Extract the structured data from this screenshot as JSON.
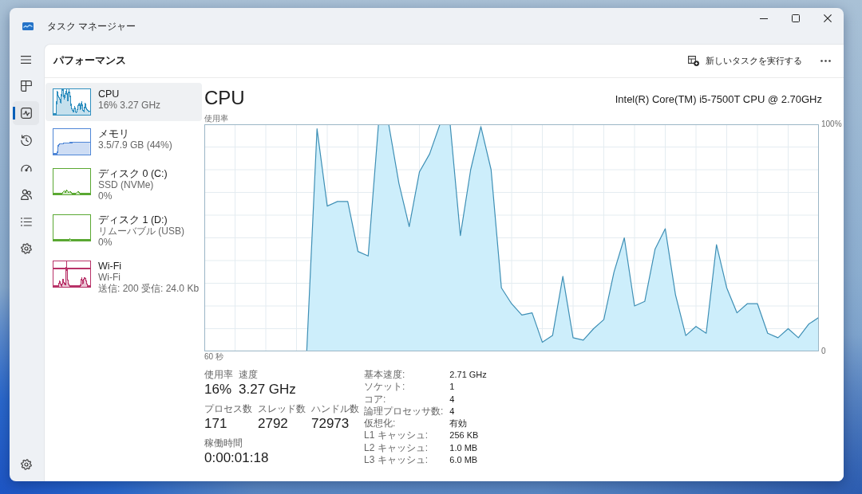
{
  "window": {
    "title": "タスク マネージャー"
  },
  "nav": [
    {
      "selected": false
    },
    {
      "selected": true
    },
    {
      "selected": false
    },
    {
      "selected": false
    },
    {
      "selected": false
    },
    {
      "selected": false
    },
    {
      "selected": false
    }
  ],
  "header": {
    "title": "パフォーマンス",
    "run_task": "新しいタスクを実行する"
  },
  "resources": [
    {
      "name": "CPU",
      "details": [
        "16% 3.27 GHz"
      ],
      "color": "#2f8fbf",
      "selected": true
    },
    {
      "name": "メモリ",
      "details": [
        "3.5/7.9 GB (44%)"
      ],
      "color": "#4f86d6",
      "selected": false
    },
    {
      "name": "ディスク 0 (C:)",
      "details": [
        "SSD (NVMe)",
        "0%"
      ],
      "color": "#5aa832",
      "selected": false
    },
    {
      "name": "ディスク 1 (D:)",
      "details": [
        "リムーバブル (USB)",
        "0%"
      ],
      "color": "#5aa832",
      "selected": false
    },
    {
      "name": "Wi-Fi",
      "details": [
        "Wi-Fi",
        "送信: 200 受信: 24.0 Kb"
      ],
      "color": "#b83268",
      "selected": false
    }
  ],
  "detail": {
    "title": "CPU",
    "model": "Intel(R) Core(TM) i5-7500T CPU @ 2.70GHz",
    "chart_data": {
      "type": "area",
      "ylabel": "使用率",
      "xlabel": "60 秒",
      "grid": true,
      "categories": [
        null,
        null,
        null,
        null,
        null,
        null,
        null,
        null,
        null,
        null,
        null,
        null,
        null,
        null,
        null,
        null,
        null,
        null,
        null,
        null,
        null,
        null,
        null,
        null,
        null,
        null,
        null,
        null,
        null,
        null,
        null,
        null,
        null,
        null,
        null,
        null,
        null,
        null,
        null,
        null,
        null,
        null,
        null,
        null,
        null,
        null,
        null,
        null,
        null,
        null,
        null,
        null,
        null,
        null,
        null,
        null,
        null,
        null,
        null,
        null,
        null
      ],
      "values": [
        0,
        0,
        0,
        0,
        0,
        0,
        0,
        0,
        0,
        0,
        0,
        98,
        64,
        66,
        66,
        44,
        42,
        100,
        100,
        74,
        55,
        79,
        87,
        100,
        100,
        51,
        80,
        99,
        80,
        28,
        21,
        16,
        17,
        4,
        7,
        33,
        6,
        5,
        10,
        14,
        35,
        50,
        20,
        22,
        45,
        54,
        25,
        7,
        11,
        8,
        47,
        28,
        17,
        21,
        21,
        8,
        6,
        10,
        6,
        12,
        15
      ],
      "ylim": [
        0,
        100
      ],
      "yticks": [
        {
          "value": 0,
          "label": "0"
        },
        {
          "value": 100,
          "label": "100%"
        }
      ]
    },
    "stats": [
      [
        {
          "label": "使用率",
          "value": "16%"
        },
        {
          "label": "速度",
          "value": "3.27 GHz"
        }
      ],
      [
        {
          "label": "プロセス数",
          "value": "171"
        },
        {
          "label": "スレッド数",
          "value": "2792"
        },
        {
          "label": "ハンドル数",
          "value": "72973"
        }
      ],
      [
        {
          "label": "稼働時間",
          "value": "0:00:01:18"
        }
      ]
    ],
    "specs": [
      {
        "label": "基本速度:",
        "value": "2.71 GHz"
      },
      {
        "label": "ソケット:",
        "value": "1"
      },
      {
        "label": "コア:",
        "value": "4"
      },
      {
        "label": "論理プロセッサ数:",
        "value": "4"
      },
      {
        "label": "仮想化:",
        "value": "有効"
      },
      {
        "label": "L1 キャッシュ:",
        "value": "256 KB"
      },
      {
        "label": "L2 キャッシュ:",
        "value": "1.0 MB"
      },
      {
        "label": "L3 キャッシュ:",
        "value": "6.0 MB"
      }
    ]
  }
}
